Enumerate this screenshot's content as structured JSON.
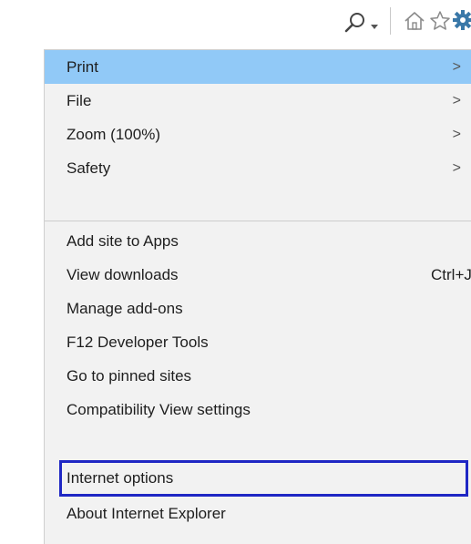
{
  "toolbar": {
    "icons": [
      "search-icon",
      "chevron-down-icon",
      "home-icon",
      "favorites-star-icon",
      "gear-icon"
    ],
    "gear_color": "#3a78a8"
  },
  "menu": {
    "highlight_color": "#91c9f7",
    "focus_color": "#1f27c4",
    "items": [
      {
        "label": "Print",
        "submenu": ">"
      },
      {
        "label": "File",
        "submenu": ">"
      },
      {
        "label": "Zoom (100%)",
        "submenu": ">"
      },
      {
        "label": "Safety",
        "submenu": ">"
      },
      {
        "label": "Add site to Apps"
      },
      {
        "label": "View downloads",
        "shortcut": "Ctrl+J"
      },
      {
        "label": "Manage add-ons"
      },
      {
        "label": "F12 Developer Tools"
      },
      {
        "label": "Go to pinned sites"
      },
      {
        "label": "Compatibility View settings"
      },
      {
        "label": "Internet options"
      },
      {
        "label": "About Internet Explorer"
      }
    ]
  }
}
